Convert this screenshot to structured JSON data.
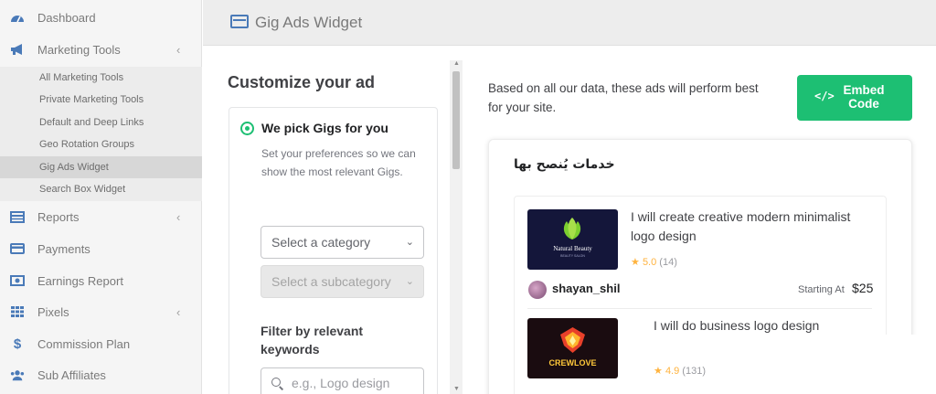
{
  "sidebar": {
    "items": [
      {
        "label": "Dashboard",
        "icon": "dashboard-icon"
      },
      {
        "label": "Marketing Tools",
        "icon": "megaphone-icon",
        "chevron": "‹"
      },
      {
        "label": "Reports",
        "icon": "reports-icon",
        "chevron": "‹"
      },
      {
        "label": "Payments",
        "icon": "credit-card-icon"
      },
      {
        "label": "Earnings Report",
        "icon": "money-icon"
      },
      {
        "label": "Pixels",
        "icon": "grid-icon",
        "chevron": "‹"
      },
      {
        "label": "Commission Plan",
        "icon": "dollar-icon"
      },
      {
        "label": "Sub Affiliates",
        "icon": "users-icon"
      }
    ],
    "sub_items": [
      {
        "label": "All Marketing Tools"
      },
      {
        "label": "Private Marketing Tools"
      },
      {
        "label": "Default and Deep Links"
      },
      {
        "label": "Geo Rotation Groups"
      },
      {
        "label": "Gig Ads Widget",
        "active": true
      },
      {
        "label": "Search Box Widget"
      }
    ]
  },
  "header": {
    "title": "Gig Ads Widget",
    "icon": "widget-icon"
  },
  "customize": {
    "title": "Customize your ad",
    "option_label": "We pick Gigs for you",
    "option_desc": "Set your preferences so we can show the most relevant Gigs.",
    "category_select": "Select a category",
    "subcategory_select": "Select a subcategory",
    "filter_label": "Filter by relevant keywords",
    "keyword_placeholder": "e.g., Logo design"
  },
  "right": {
    "perf_text": "Based on all our data, these ads will perform best for your site.",
    "embed_label": "Embed Code",
    "embed_icon": "</>",
    "preview_title": "خدمات يُنصح بها",
    "gigs": [
      {
        "title": "I will create creative modern minimalist logo design",
        "rating": "5.0",
        "reviews": "(14)",
        "seller": "shayan_shil",
        "price_label": "Starting At",
        "price": "$25",
        "image_text": "Natural Beauty",
        "image_subtext": "BEAUTY SALON"
      },
      {
        "title": "I will do business logo design",
        "rating": "4.9",
        "reviews": "(131)",
        "image_text": "CREWLOVE"
      }
    ]
  },
  "colors": {
    "accent": "#1dbf73",
    "brand_blue": "#4a7ab8",
    "star": "#ffb33e"
  }
}
